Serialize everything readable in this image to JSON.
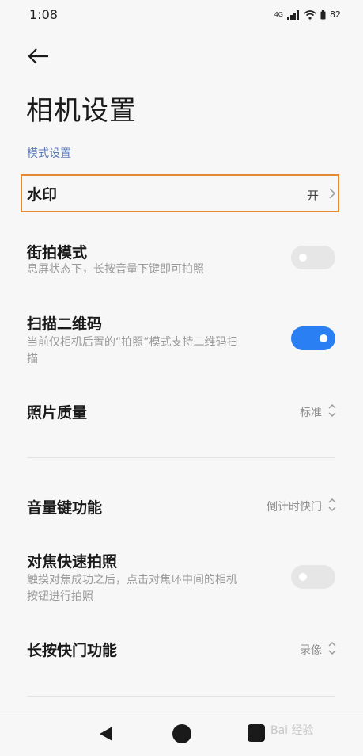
{
  "status_bar": {
    "time": "1:08",
    "network": "4G",
    "battery": "82"
  },
  "header": {
    "title": "相机设置",
    "section_label": "模式设置"
  },
  "rows": {
    "watermark": {
      "title": "水印",
      "value": "开"
    },
    "street_mode": {
      "title": "街拍模式",
      "desc": "息屏状态下，长按音量下键即可拍照",
      "toggle": "off"
    },
    "qr_scan": {
      "title": "扫描二维码",
      "desc_line1": "当前仅相机后置的“拍照”模式支持二维码扫",
      "desc_line2": "描",
      "toggle": "on"
    },
    "photo_quality": {
      "title": "照片质量",
      "value": "标准"
    },
    "volume_key": {
      "title": "音量键功能",
      "value": "倒计时快门"
    },
    "focus_shot": {
      "title": "对焦快速拍照",
      "desc_line1": "触摸对焦成功之后，点击对焦环中间的相机",
      "desc_line2": "按钮进行拍照",
      "toggle": "off"
    },
    "long_press_shutter": {
      "title": "长按快门功能",
      "value": "录像"
    }
  },
  "nav_bar": {
    "back_icon": "triangle-back-icon",
    "home_icon": "circle-home-icon",
    "recent_icon": "square-recent-icon",
    "watermark_text": "Bai 经验"
  },
  "colors": {
    "accent_blue": "#2a7ff2",
    "section_label": "#5b7ab5",
    "highlight_orange": "#e58a33"
  }
}
